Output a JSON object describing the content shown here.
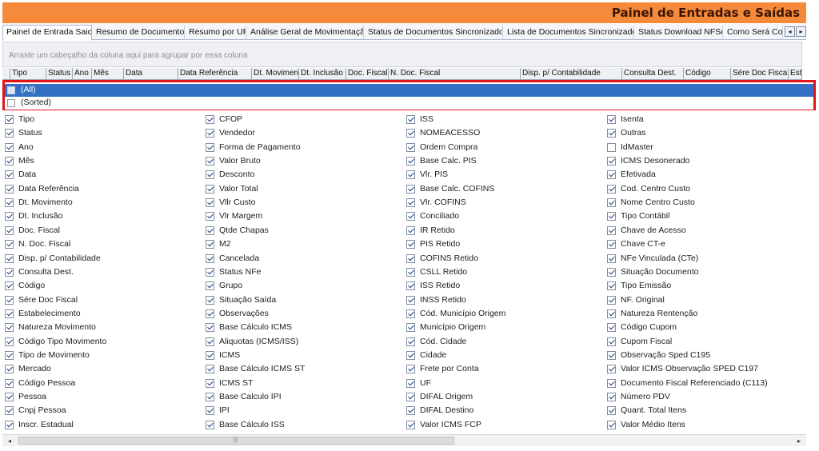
{
  "window": {
    "title": "Painel de Entradas e Saídas"
  },
  "tabs": [
    {
      "label": "Painel de Entrada Saida",
      "active": true
    },
    {
      "label": "Resumo de Documentos"
    },
    {
      "label": "Resumo por UF"
    },
    {
      "label": "Análise Geral de Movimentação"
    },
    {
      "label": "Status de Documentos Sincronizados"
    },
    {
      "label": "Lista de Documentos Sincronizados"
    },
    {
      "label": "Status Download NFSe"
    },
    {
      "label": "Como Será Cor"
    }
  ],
  "tab_scroll": {
    "left": "◂",
    "right": "▸"
  },
  "group_panel": {
    "hint": "Arraste um cabeçalho da coluna aqui para agrupar por essa coluna"
  },
  "columns": [
    "Tipo",
    "Status",
    "Ano",
    "Mês",
    "Data",
    "Data Referência",
    "Dt. Movimen",
    "Dt. Inclusão",
    "Doc. Fiscal",
    "N. Doc. Fiscal",
    "Disp. p/ Contabilidade",
    "Consulta Dest.",
    "Código",
    "Sére Doc Fiscal",
    "Esta"
  ],
  "filter": {
    "all_label": "(All)",
    "sorted_label": "(Sorted)"
  },
  "field_columns": [
    [
      {
        "label": "Tipo",
        "checked": true
      },
      {
        "label": "Status",
        "checked": true
      },
      {
        "label": "Ano",
        "checked": true
      },
      {
        "label": "Mês",
        "checked": true
      },
      {
        "label": "Data",
        "checked": true
      },
      {
        "label": "Data Referência",
        "checked": true
      },
      {
        "label": "Dt. Movimento",
        "checked": true
      },
      {
        "label": "Dt. Inclusão",
        "checked": true
      },
      {
        "label": "Doc. Fiscal",
        "checked": true
      },
      {
        "label": "N. Doc. Fiscal",
        "checked": true
      },
      {
        "label": "Disp. p/ Contabilidade",
        "checked": true
      },
      {
        "label": "Consulta Dest.",
        "checked": true
      },
      {
        "label": "Código",
        "checked": true
      },
      {
        "label": "Sére Doc Fiscal",
        "checked": true
      },
      {
        "label": "Estabelecimento",
        "checked": true
      },
      {
        "label": "Natureza Movimento",
        "checked": true
      },
      {
        "label": "Código Tipo Movimento",
        "checked": true
      },
      {
        "label": "Tipo de Movimento",
        "checked": true
      },
      {
        "label": "Mercado",
        "checked": true
      },
      {
        "label": "Código Pessoa",
        "checked": true
      },
      {
        "label": "Pessoa",
        "checked": true
      },
      {
        "label": "Cnpj Pessoa",
        "checked": true
      },
      {
        "label": "Inscr. Estadual",
        "checked": true
      }
    ],
    [
      {
        "label": "CFOP",
        "checked": true
      },
      {
        "label": "Vendedor",
        "checked": true
      },
      {
        "label": "Forma de Pagamento",
        "checked": true
      },
      {
        "label": "Valor Bruto",
        "checked": true
      },
      {
        "label": "Desconto",
        "checked": true
      },
      {
        "label": "Valor Total",
        "checked": true
      },
      {
        "label": "Vllr Custo",
        "checked": true
      },
      {
        "label": "Vlr Margem",
        "checked": true
      },
      {
        "label": "Qtde Chapas",
        "checked": true
      },
      {
        "label": "M2",
        "checked": true
      },
      {
        "label": "Cancelada",
        "checked": true
      },
      {
        "label": "Status NFe",
        "checked": true
      },
      {
        "label": "Grupo",
        "checked": true
      },
      {
        "label": "Situação Saída",
        "checked": true
      },
      {
        "label": "Observações",
        "checked": true
      },
      {
        "label": "Base Cálculo ICMS",
        "checked": true
      },
      {
        "label": "Aliquotas (ICMS/ISS)",
        "checked": true
      },
      {
        "label": "ICMS",
        "checked": true
      },
      {
        "label": "Base Cálculo ICMS ST",
        "checked": true
      },
      {
        "label": "ICMS ST",
        "checked": true
      },
      {
        "label": "Base Calculo IPI",
        "checked": true
      },
      {
        "label": "IPI",
        "checked": true
      },
      {
        "label": "Base Cálculo ISS",
        "checked": true
      }
    ],
    [
      {
        "label": "ISS",
        "checked": true
      },
      {
        "label": "NOMEACESSO",
        "checked": true
      },
      {
        "label": "Ordem Compra",
        "checked": true
      },
      {
        "label": "Base Calc. PIS",
        "checked": true
      },
      {
        "label": "Vlr. PIS",
        "checked": true
      },
      {
        "label": "Base Calc. COFINS",
        "checked": true
      },
      {
        "label": "Vlr. COFINS",
        "checked": true
      },
      {
        "label": "Conciliado",
        "checked": true
      },
      {
        "label": "IR Retido",
        "checked": true
      },
      {
        "label": "PIS Retido",
        "checked": true
      },
      {
        "label": "COFINS Retido",
        "checked": true
      },
      {
        "label": "CSLL Retido",
        "checked": true
      },
      {
        "label": "ISS Retido",
        "checked": true
      },
      {
        "label": "INSS Retido",
        "checked": true
      },
      {
        "label": "Cód. Município Origem",
        "checked": true
      },
      {
        "label": "Município Origem",
        "checked": true
      },
      {
        "label": "Cód. Cidade",
        "checked": true
      },
      {
        "label": "Cidade",
        "checked": true
      },
      {
        "label": "Frete por Conta",
        "checked": true
      },
      {
        "label": "UF",
        "checked": true
      },
      {
        "label": "DIFAL Origem",
        "checked": true
      },
      {
        "label": "DIFAL Destino",
        "checked": true
      },
      {
        "label": "Valor ICMS FCP",
        "checked": true
      }
    ],
    [
      {
        "label": "Isenta",
        "checked": true
      },
      {
        "label": "Outras",
        "checked": true
      },
      {
        "label": "IdMaster",
        "checked": false
      },
      {
        "label": "ICMS Desonerado",
        "checked": true
      },
      {
        "label": "Efetivada",
        "checked": true
      },
      {
        "label": "Cod. Centro Custo",
        "checked": true
      },
      {
        "label": "Nome Centro Custo",
        "checked": true
      },
      {
        "label": "Tipo Contábil",
        "checked": true
      },
      {
        "label": "Chave de Acesso",
        "checked": true
      },
      {
        "label": "Chave CT-e",
        "checked": true
      },
      {
        "label": "NFe Vinculada (CTe)",
        "checked": true
      },
      {
        "label": "Situação Documento",
        "checked": true
      },
      {
        "label": "Tipo Emissão",
        "checked": true
      },
      {
        "label": "NF.  Original",
        "checked": true
      },
      {
        "label": "Natureza Rentenção",
        "checked": true
      },
      {
        "label": "Código Cupom",
        "checked": true
      },
      {
        "label": "Cupom  Fiscal",
        "checked": true
      },
      {
        "label": "Observação Sped C195",
        "checked": true
      },
      {
        "label": "Valor ICMS Observação SPED C197",
        "checked": true
      },
      {
        "label": "Documento Fiscal Referenciado (C113)",
        "checked": true
      },
      {
        "label": "Número PDV",
        "checked": true
      },
      {
        "label": "Quant. Total Itens",
        "checked": true
      },
      {
        "label": "Valor Médio Itens",
        "checked": true
      }
    ]
  ],
  "scrollbar": {
    "left": "◂",
    "right": "▸",
    "grip": "|||"
  }
}
